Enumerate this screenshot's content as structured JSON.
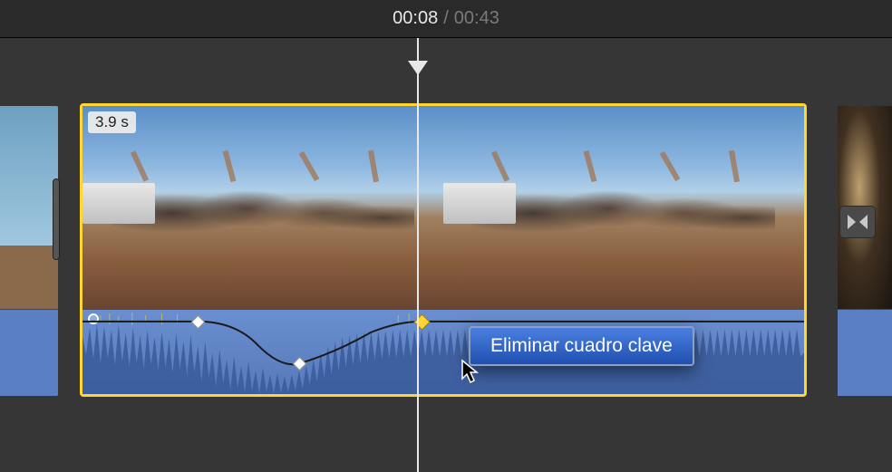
{
  "timecode": {
    "current": "00:08",
    "separator": "/",
    "total": "00:43"
  },
  "clip": {
    "duration_label": "3.9 s"
  },
  "context_menu": {
    "items": [
      {
        "label": "Eliminar cuadro clave"
      }
    ]
  },
  "audio": {
    "keyframes": [
      {
        "pct_x": 16,
        "pct_y": 14,
        "selected": false
      },
      {
        "pct_x": 30,
        "pct_y": 62,
        "selected": false
      },
      {
        "pct_x": 47,
        "pct_y": 14,
        "selected": true
      }
    ]
  },
  "icons": {
    "transition": "transition-icon"
  }
}
